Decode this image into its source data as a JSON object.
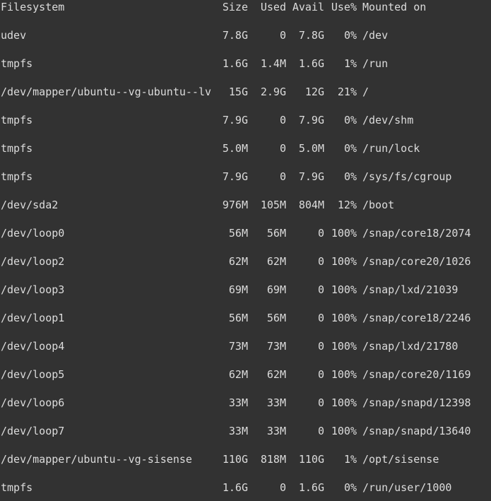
{
  "theme": {
    "background": "#323232",
    "foreground": "#dcdcdc"
  },
  "header": {
    "filesystem": "Filesystem",
    "size": "Size",
    "used": "Used",
    "avail": "Avail",
    "use_pct": "Use%",
    "mounted_on": "Mounted on"
  },
  "rows": [
    {
      "filesystem": "udev",
      "size": "7.8G",
      "used": "0",
      "avail": "7.8G",
      "use_pct": "0%",
      "mounted_on": "/dev"
    },
    {
      "filesystem": "tmpfs",
      "size": "1.6G",
      "used": "1.4M",
      "avail": "1.6G",
      "use_pct": "1%",
      "mounted_on": "/run"
    },
    {
      "filesystem": "/dev/mapper/ubuntu--vg-ubuntu--lv",
      "size": "15G",
      "used": "2.9G",
      "avail": "12G",
      "use_pct": "21%",
      "mounted_on": "/"
    },
    {
      "filesystem": "tmpfs",
      "size": "7.9G",
      "used": "0",
      "avail": "7.9G",
      "use_pct": "0%",
      "mounted_on": "/dev/shm"
    },
    {
      "filesystem": "tmpfs",
      "size": "5.0M",
      "used": "0",
      "avail": "5.0M",
      "use_pct": "0%",
      "mounted_on": "/run/lock"
    },
    {
      "filesystem": "tmpfs",
      "size": "7.9G",
      "used": "0",
      "avail": "7.9G",
      "use_pct": "0%",
      "mounted_on": "/sys/fs/cgroup"
    },
    {
      "filesystem": "/dev/sda2",
      "size": "976M",
      "used": "105M",
      "avail": "804M",
      "use_pct": "12%",
      "mounted_on": "/boot"
    },
    {
      "filesystem": "/dev/loop0",
      "size": "56M",
      "used": "56M",
      "avail": "0",
      "use_pct": "100%",
      "mounted_on": "/snap/core18/2074"
    },
    {
      "filesystem": "/dev/loop2",
      "size": "62M",
      "used": "62M",
      "avail": "0",
      "use_pct": "100%",
      "mounted_on": "/snap/core20/1026"
    },
    {
      "filesystem": "/dev/loop3",
      "size": "69M",
      "used": "69M",
      "avail": "0",
      "use_pct": "100%",
      "mounted_on": "/snap/lxd/21039"
    },
    {
      "filesystem": "/dev/loop1",
      "size": "56M",
      "used": "56M",
      "avail": "0",
      "use_pct": "100%",
      "mounted_on": "/snap/core18/2246"
    },
    {
      "filesystem": "/dev/loop4",
      "size": "73M",
      "used": "73M",
      "avail": "0",
      "use_pct": "100%",
      "mounted_on": "/snap/lxd/21780"
    },
    {
      "filesystem": "/dev/loop5",
      "size": "62M",
      "used": "62M",
      "avail": "0",
      "use_pct": "100%",
      "mounted_on": "/snap/core20/1169"
    },
    {
      "filesystem": "/dev/loop6",
      "size": "33M",
      "used": "33M",
      "avail": "0",
      "use_pct": "100%",
      "mounted_on": "/snap/snapd/12398"
    },
    {
      "filesystem": "/dev/loop7",
      "size": "33M",
      "used": "33M",
      "avail": "0",
      "use_pct": "100%",
      "mounted_on": "/snap/snapd/13640"
    },
    {
      "filesystem": "/dev/mapper/ubuntu--vg-sisense",
      "size": "110G",
      "used": "818M",
      "avail": "110G",
      "use_pct": "1%",
      "mounted_on": "/opt/sisense"
    },
    {
      "filesystem": "tmpfs",
      "size": "1.6G",
      "used": "0",
      "avail": "1.6G",
      "use_pct": "0%",
      "mounted_on": "/run/user/1000"
    }
  ]
}
